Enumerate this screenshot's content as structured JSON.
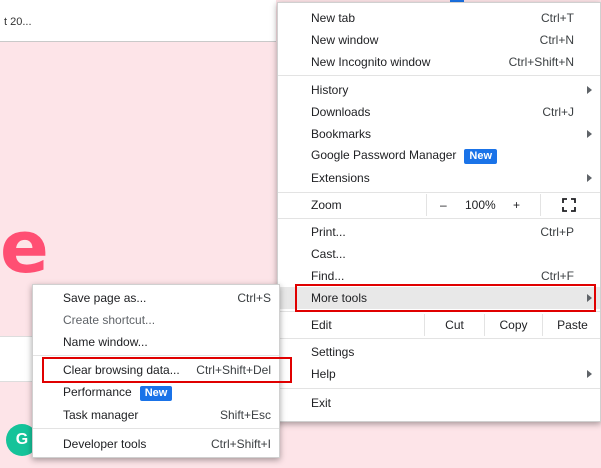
{
  "background": {
    "tab_text": "t 20...",
    "logo_letter": "e",
    "circle_letter": "G"
  },
  "main_menu": {
    "new_tab": {
      "label": "New tab",
      "shortcut": "Ctrl+T"
    },
    "new_window": {
      "label": "New window",
      "shortcut": "Ctrl+N"
    },
    "new_incognito": {
      "label": "New Incognito window",
      "shortcut": "Ctrl+Shift+N"
    },
    "history": {
      "label": "History"
    },
    "downloads": {
      "label": "Downloads",
      "shortcut": "Ctrl+J"
    },
    "bookmarks": {
      "label": "Bookmarks"
    },
    "password_manager": {
      "label": "Google Password Manager",
      "badge": "New"
    },
    "extensions": {
      "label": "Extensions"
    },
    "zoom": {
      "label": "Zoom",
      "minus": "–",
      "value": "100%",
      "plus": "+"
    },
    "print": {
      "label": "Print...",
      "shortcut": "Ctrl+P"
    },
    "cast": {
      "label": "Cast..."
    },
    "find": {
      "label": "Find...",
      "shortcut": "Ctrl+F"
    },
    "more_tools": {
      "label": "More tools"
    },
    "edit": {
      "label": "Edit",
      "cut": "Cut",
      "copy": "Copy",
      "paste": "Paste"
    },
    "settings": {
      "label": "Settings"
    },
    "help": {
      "label": "Help"
    },
    "exit": {
      "label": "Exit"
    }
  },
  "sub_menu": {
    "save_page": {
      "label": "Save page as...",
      "shortcut": "Ctrl+S"
    },
    "create_shortcut": {
      "label": "Create shortcut..."
    },
    "name_window": {
      "label": "Name window..."
    },
    "clear_browsing": {
      "label": "Clear browsing data...",
      "shortcut": "Ctrl+Shift+Del"
    },
    "performance": {
      "label": "Performance",
      "badge": "New"
    },
    "task_manager": {
      "label": "Task manager",
      "shortcut": "Shift+Esc"
    },
    "developer_tools": {
      "label": "Developer tools",
      "shortcut": "Ctrl+Shift+I"
    }
  },
  "colors": {
    "highlight": "#e00000",
    "badge": "#1a73e8",
    "page_bg": "#fde4e8"
  }
}
